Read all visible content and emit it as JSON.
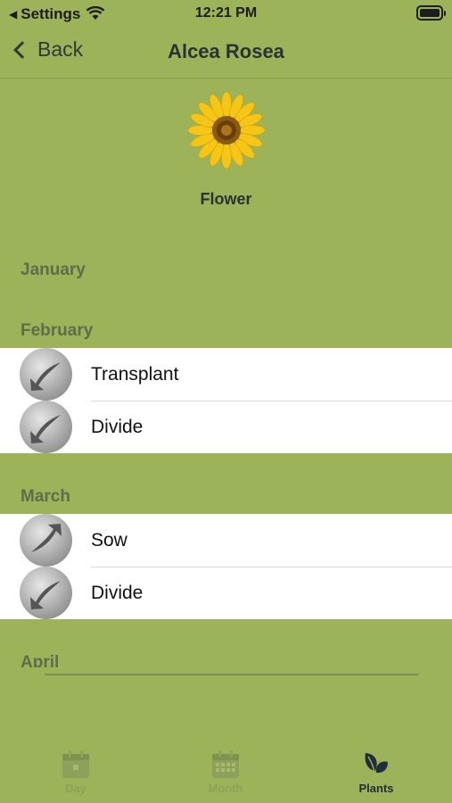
{
  "status_bar": {
    "back_app": "Settings",
    "time": "12:21 PM"
  },
  "nav": {
    "back_label": "Back",
    "title": "Alcea Rosea"
  },
  "plant": {
    "image_icon": "sunflower-icon",
    "type": "Flower"
  },
  "months": [
    {
      "name": "January",
      "actions": []
    },
    {
      "name": "February",
      "actions": [
        {
          "label": "Transplant",
          "icon": "moon-waning-arrow-icon"
        },
        {
          "label": "Divide",
          "icon": "moon-waning-arrow-icon"
        }
      ]
    },
    {
      "name": "March",
      "actions": [
        {
          "label": "Sow",
          "icon": "moon-waxing-arrow-icon"
        },
        {
          "label": "Divide",
          "icon": "moon-waning-arrow-icon"
        }
      ]
    },
    {
      "name": "April",
      "actions": []
    }
  ],
  "tabs": [
    {
      "label": "Day",
      "icon": "calendar-day-icon",
      "active": false
    },
    {
      "label": "Month",
      "icon": "calendar-month-icon",
      "active": false
    },
    {
      "label": "Plants",
      "icon": "leaves-icon",
      "active": true
    }
  ],
  "colors": {
    "background": "#9db359",
    "header_text": "#5f6d4a",
    "active_tab": "#1f2e3a",
    "inactive_tab": "#8ea15a"
  }
}
